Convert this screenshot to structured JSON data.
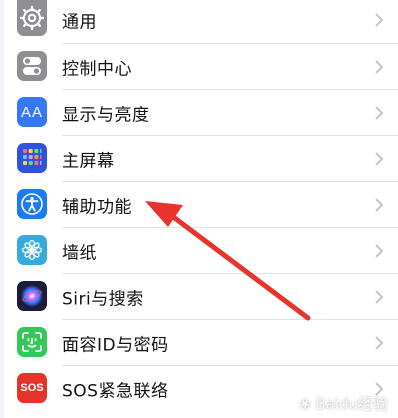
{
  "settings": {
    "items": [
      {
        "label": "通用",
        "icon": "gear-icon",
        "color": "#8e8e93"
      },
      {
        "label": "控制中心",
        "icon": "toggles-icon",
        "color": "#8e8e93"
      },
      {
        "label": "显示与亮度",
        "icon": "text-size-icon",
        "color": "#3478f6",
        "icon_text": "AA"
      },
      {
        "label": "主屏幕",
        "icon": "home-grid-icon",
        "color": "#2f54d9"
      },
      {
        "label": "辅助功能",
        "icon": "accessibility-icon",
        "color": "#1a7cf5"
      },
      {
        "label": "墙纸",
        "icon": "flower-icon",
        "color": "#35aadc"
      },
      {
        "label": "Siri与搜索",
        "icon": "siri-icon",
        "color": "#1c1c3a"
      },
      {
        "label": "面容ID与密码",
        "icon": "face-id-icon",
        "color": "#34c759"
      },
      {
        "label": "SOS紧急联络",
        "icon": "sos-icon",
        "color": "#e5332a",
        "icon_text": "SOS"
      }
    ]
  },
  "annotation": {
    "arrow_color": "#e8342c"
  },
  "watermark": {
    "text": "Baidu经验"
  }
}
